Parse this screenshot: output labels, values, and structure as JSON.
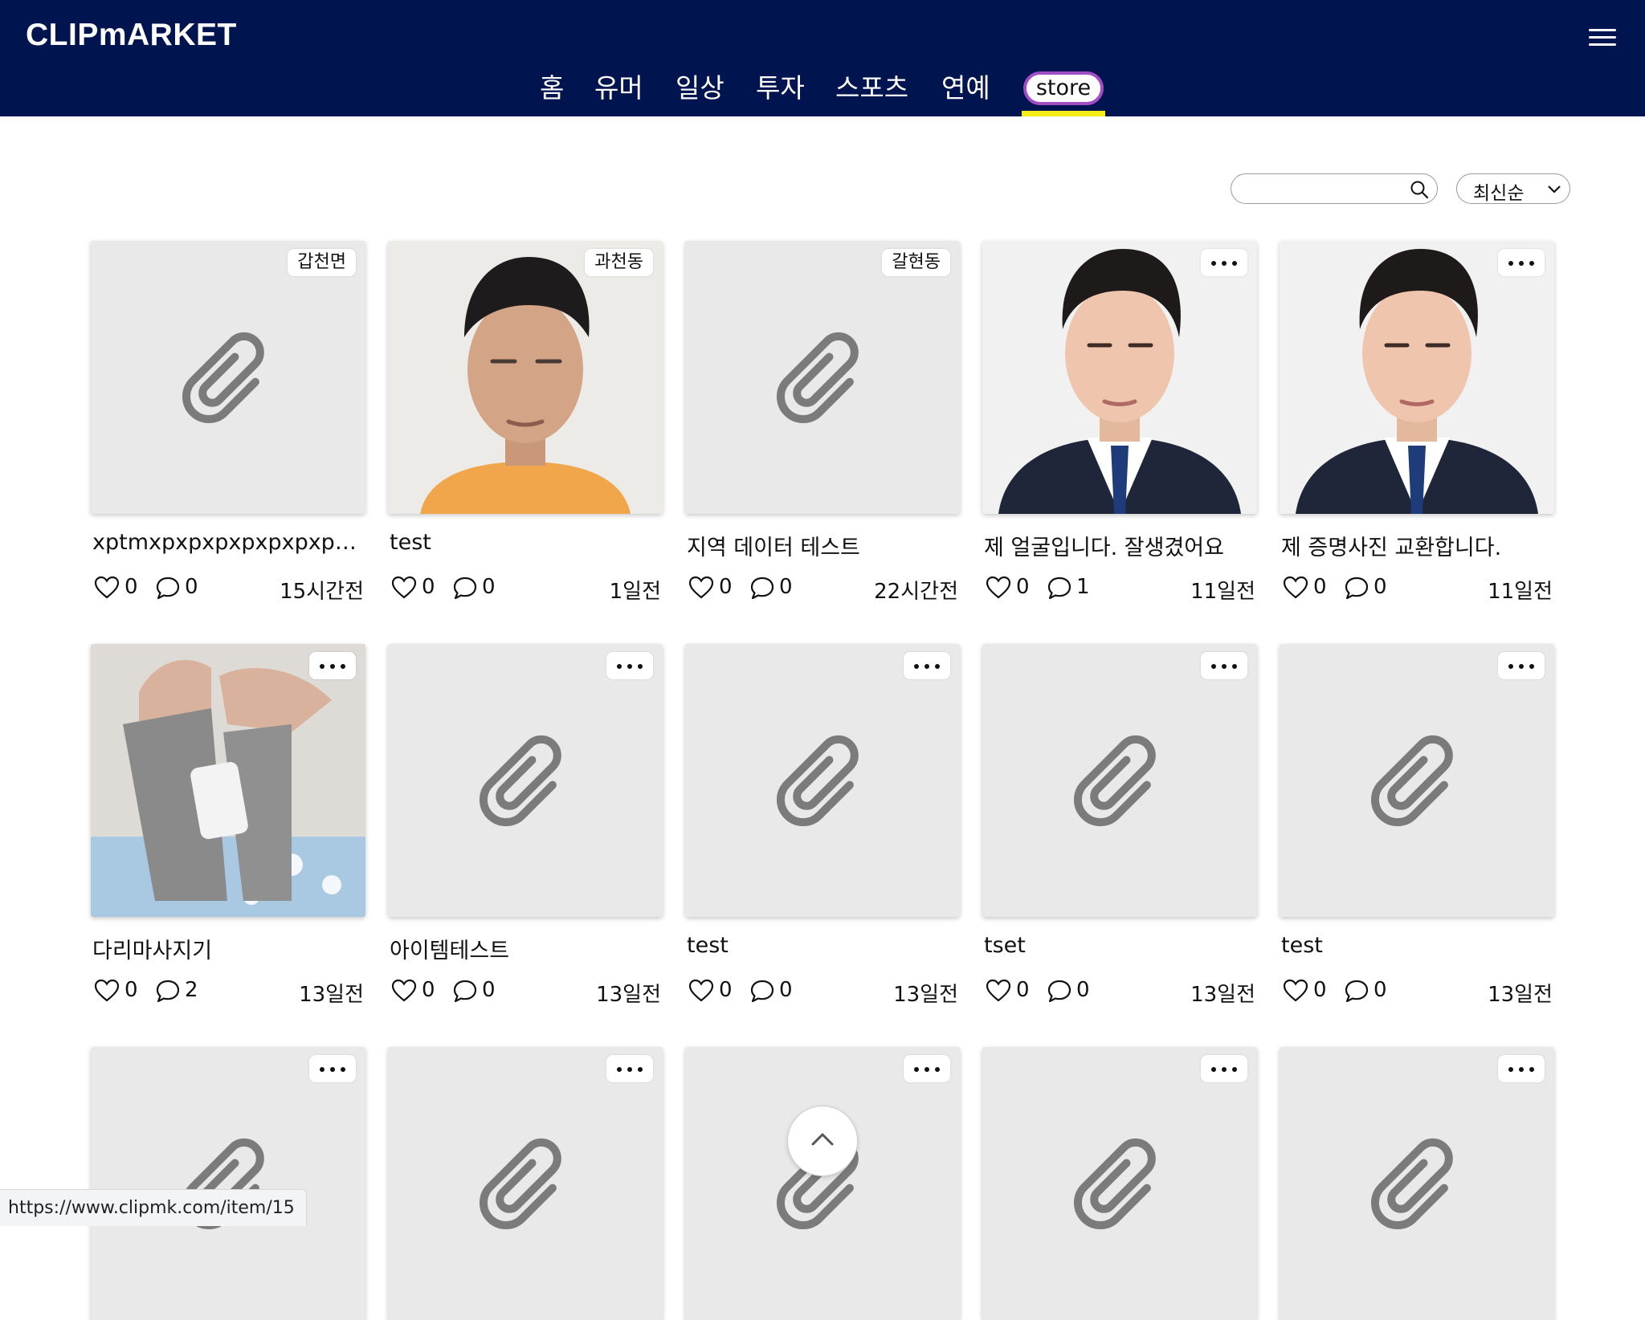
{
  "app": {
    "logo": "CLIPmARKET"
  },
  "nav": {
    "items": [
      "홈",
      "유머",
      "일상",
      "투자",
      "스포츠",
      "연예"
    ],
    "store_label": "store"
  },
  "toolbar": {
    "search_placeholder": "",
    "sort_selected": "최신순"
  },
  "cards": [
    {
      "title": "xptmxpxpxpxpxpxpxpxpp...",
      "badge": "갑천면",
      "likes": "0",
      "comments": "0",
      "time": "15시간전"
    },
    {
      "title": "test",
      "badge": "과천동",
      "likes": "0",
      "comments": "0",
      "time": "1일전"
    },
    {
      "title": "지역 데이터 테스트",
      "badge": "갈현동",
      "likes": "0",
      "comments": "0",
      "time": "22시간전"
    },
    {
      "title": "제 얼굴입니다. 잘생겼어요",
      "likes": "0",
      "comments": "1",
      "time": "11일전"
    },
    {
      "title": "제 증명사진 교환합니다.",
      "likes": "0",
      "comments": "0",
      "time": "11일전"
    },
    {
      "title": "다리마사지기",
      "likes": "0",
      "comments": "2",
      "time": "13일전"
    },
    {
      "title": "아이템테스트",
      "likes": "0",
      "comments": "0",
      "time": "13일전"
    },
    {
      "title": "test",
      "likes": "0",
      "comments": "0",
      "time": "13일전"
    },
    {
      "title": "tset",
      "likes": "0",
      "comments": "0",
      "time": "13일전"
    },
    {
      "title": "test",
      "likes": "0",
      "comments": "0",
      "time": "13일전"
    }
  ],
  "status_url": "https://www.clipmk.com/item/15",
  "colors": {
    "header_bg": "#001450",
    "store_border": "#a14ec4",
    "active_underline": "#f5ee16",
    "placeholder_bg": "#e9e9e9"
  }
}
